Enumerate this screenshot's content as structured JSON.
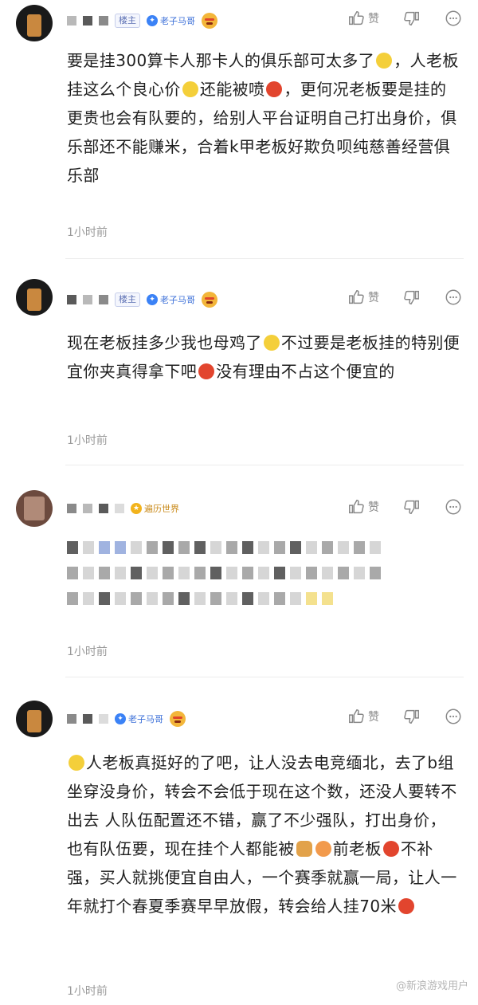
{
  "comments": [
    {
      "has_owner_tag": true,
      "owner_tag": "楼主",
      "badge": "老子马哥",
      "action_like": "赞",
      "text_a": "要是挂300算卡人那卡人的俱乐部可太多了",
      "text_b": "，人老板挂这么个良心价",
      "text_c": "还能被喷",
      "text_d": "，更何况老板要是挂的更贵也会有队要的，给别人平台证明自己打出身价，俱乐部还不能赚米，合着k甲老板好欺负呗纯慈善经营俱乐部",
      "time": "1小时前"
    },
    {
      "has_owner_tag": true,
      "owner_tag": "楼主",
      "badge": "老子马哥",
      "action_like": "赞",
      "text_a": "现在老板挂多少我也母鸡了",
      "text_b": "不过要是老板挂的特别便宜你夹真得拿下吧",
      "text_c": "没有理由不占这个便宜的",
      "time": "1小时前"
    },
    {
      "badge": "遍历世界",
      "action_like": "赞",
      "time": "1小时前"
    },
    {
      "badge": "老子马哥",
      "action_like": "赞",
      "text_a": "人老板真挺好的了吧，让人没去电竞缅北，去了b组坐穿没身价，转会不会低于现在这个数，还没人要转不出去 人队伍配置还不错，赢了不少强队，打出身价，也有队伍要，现在挂个人都能被",
      "text_b": "前老板",
      "text_c": "不补强，买人就挑便宜自由人，一个赛季就赢一局，让人一年就打个春夏季赛早早放假，转会给人挂70米",
      "time": "1小时前"
    }
  ],
  "watermark": "@新浪游戏用户",
  "icons": [
    "thumb-up-icon",
    "thumb-down-icon",
    "reply-icon"
  ]
}
